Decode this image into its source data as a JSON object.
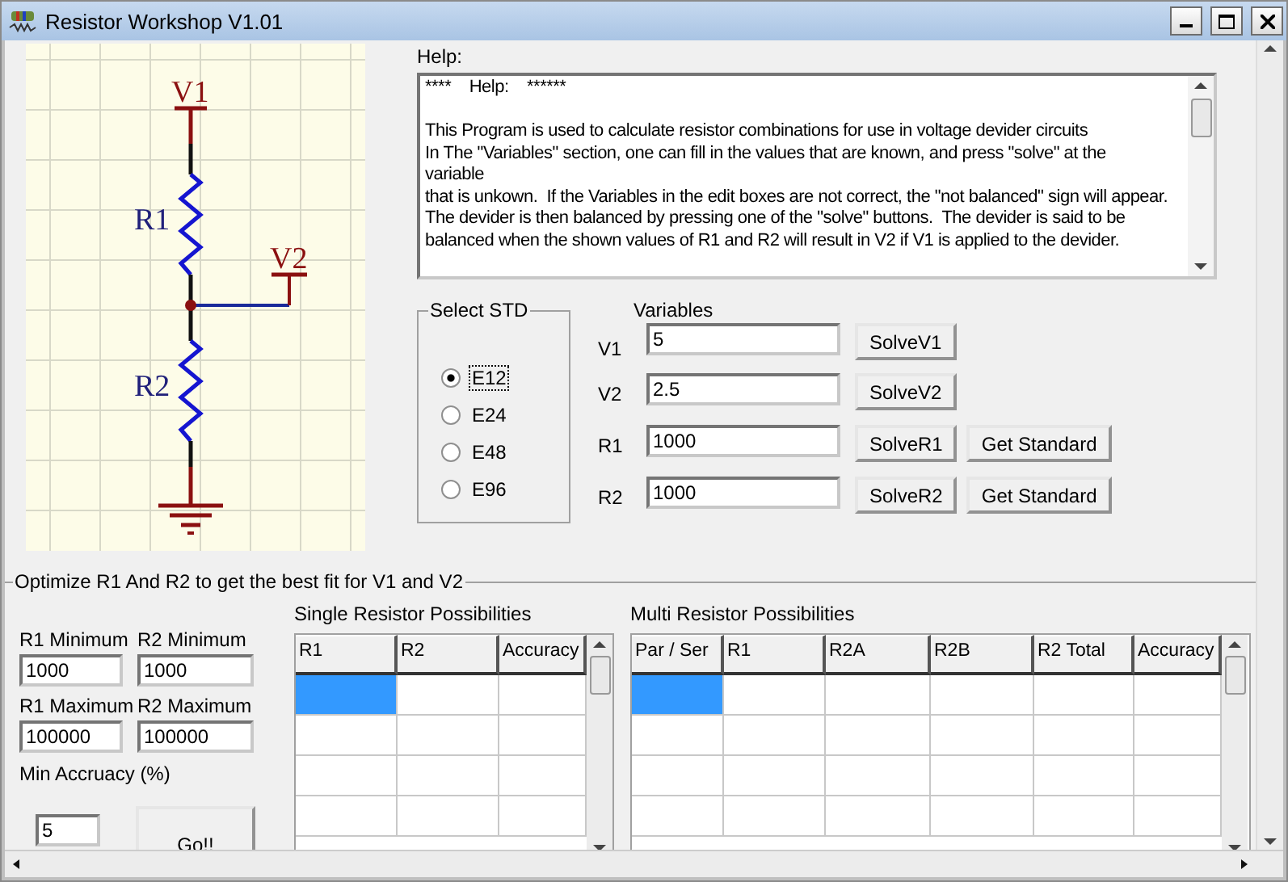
{
  "window": {
    "title": "Resistor Workshop V1.01"
  },
  "schematic": {
    "labels": [
      "V1",
      "R1",
      "V2",
      "R2"
    ]
  },
  "help": {
    "label": "Help:",
    "lines": [
      "****    Help:    ******",
      "This Program is used to calculate resistor combinations for use in voltage devider circuits",
      "In The \"Variables\" section, one can fill in the values that are known, and press \"solve\" at the",
      "variable",
      "that is unkown.  If the Variables in the edit boxes are not correct, the \"not balanced\" sign will appear.",
      "The devider is then balanced by pressing one of the \"solve\" buttons.  The devider is said to be",
      "balanced when the shown values of R1 and R2 will result in V2 if V1 is applied to the devider."
    ]
  },
  "select_std": {
    "title": "Select STD",
    "options": [
      {
        "label": "E12",
        "selected": true
      },
      {
        "label": "E24",
        "selected": false
      },
      {
        "label": "E48",
        "selected": false
      },
      {
        "label": "E96",
        "selected": false
      }
    ]
  },
  "variables": {
    "title": "Variables",
    "rows": [
      {
        "label": "V1",
        "value": "5",
        "buttons": [
          "SolveV1"
        ]
      },
      {
        "label": "V2",
        "value": "2.5",
        "buttons": [
          "SolveV2"
        ]
      },
      {
        "label": "R1",
        "value": "1000",
        "buttons": [
          "SolveR1",
          "Get Standard"
        ]
      },
      {
        "label": "R2",
        "value": "1000",
        "buttons": [
          "SolveR2",
          "Get Standard"
        ]
      }
    ]
  },
  "optimize": {
    "title": "Optimize R1 And R2 to get the best fit for V1 and V2",
    "fields": [
      {
        "label": "R1 Minimum",
        "value": "1000"
      },
      {
        "label": "R2 Minimum",
        "value": "1000"
      },
      {
        "label": "R1 Maximum",
        "value": "100000"
      },
      {
        "label": "R2 Maximum",
        "value": "100000"
      }
    ],
    "min_accuracy": {
      "label": "Min Accruacy (%)",
      "value": "5"
    },
    "go_button": "Go!!",
    "single": {
      "title": "Single Resistor Possibilities",
      "columns": [
        "R1",
        "R2",
        "Accuracy"
      ],
      "rows": [
        {
          "selected": true
        },
        {
          "selected": false
        },
        {
          "selected": false
        },
        {
          "selected": false
        }
      ]
    },
    "multi": {
      "title": "Multi Resistor Possibilities",
      "columns": [
        "Par / Ser",
        "R1",
        "R2A",
        "R2B",
        "R2 Total",
        "Accuracy"
      ],
      "rows": [
        {
          "selected": true
        },
        {
          "selected": false
        },
        {
          "selected": false
        },
        {
          "selected": false
        }
      ]
    }
  }
}
